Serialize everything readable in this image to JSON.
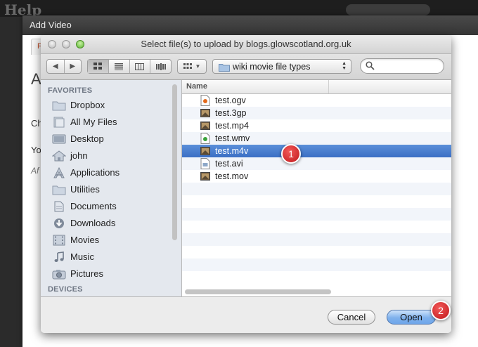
{
  "background": {
    "logo_text": "Help",
    "add_video_title": "Add Video",
    "tab_label": "F",
    "big_letter": "A",
    "line_ch": "Ch",
    "line_yo": "Yo",
    "line_af": "Af"
  },
  "dialog": {
    "title": "Select file(s) to upload by blogs.glowscotland.org.uk",
    "path_popup": "wiki movie file types",
    "search_placeholder": ""
  },
  "sidebar": {
    "favorites_heading": "FAVORITES",
    "devices_heading": "DEVICES",
    "items": [
      {
        "label": "Dropbox",
        "icon": "folder-icon"
      },
      {
        "label": "All My Files",
        "icon": "all-files-icon"
      },
      {
        "label": "Desktop",
        "icon": "desktop-icon"
      },
      {
        "label": "john",
        "icon": "home-icon"
      },
      {
        "label": "Applications",
        "icon": "applications-icon"
      },
      {
        "label": "Utilities",
        "icon": "folder-icon"
      },
      {
        "label": "Documents",
        "icon": "documents-icon"
      },
      {
        "label": "Downloads",
        "icon": "downloads-icon"
      },
      {
        "label": "Movies",
        "icon": "movies-icon"
      },
      {
        "label": "Music",
        "icon": "music-icon"
      },
      {
        "label": "Pictures",
        "icon": "camera-icon"
      }
    ]
  },
  "filelist": {
    "column_name": "Name",
    "files": [
      {
        "name": "test.ogv",
        "icon": "ogv-file-icon",
        "selected": false
      },
      {
        "name": "test.3gp",
        "icon": "video-thumb-icon",
        "selected": false
      },
      {
        "name": "test.mp4",
        "icon": "video-thumb-icon",
        "selected": false
      },
      {
        "name": "test.wmv",
        "icon": "wmv-file-icon",
        "selected": false
      },
      {
        "name": "test.m4v",
        "icon": "video-thumb-icon",
        "selected": true
      },
      {
        "name": "test.avi",
        "icon": "avi-file-icon",
        "selected": false
      },
      {
        "name": "test.mov",
        "icon": "video-thumb-icon",
        "selected": false
      }
    ]
  },
  "buttons": {
    "cancel": "Cancel",
    "open": "Open"
  },
  "callouts": {
    "first": "1",
    "second": "2"
  },
  "colors": {
    "selection": "#3d75c8",
    "callout": "#d52b2e",
    "open_button": "#7fb1ec"
  }
}
